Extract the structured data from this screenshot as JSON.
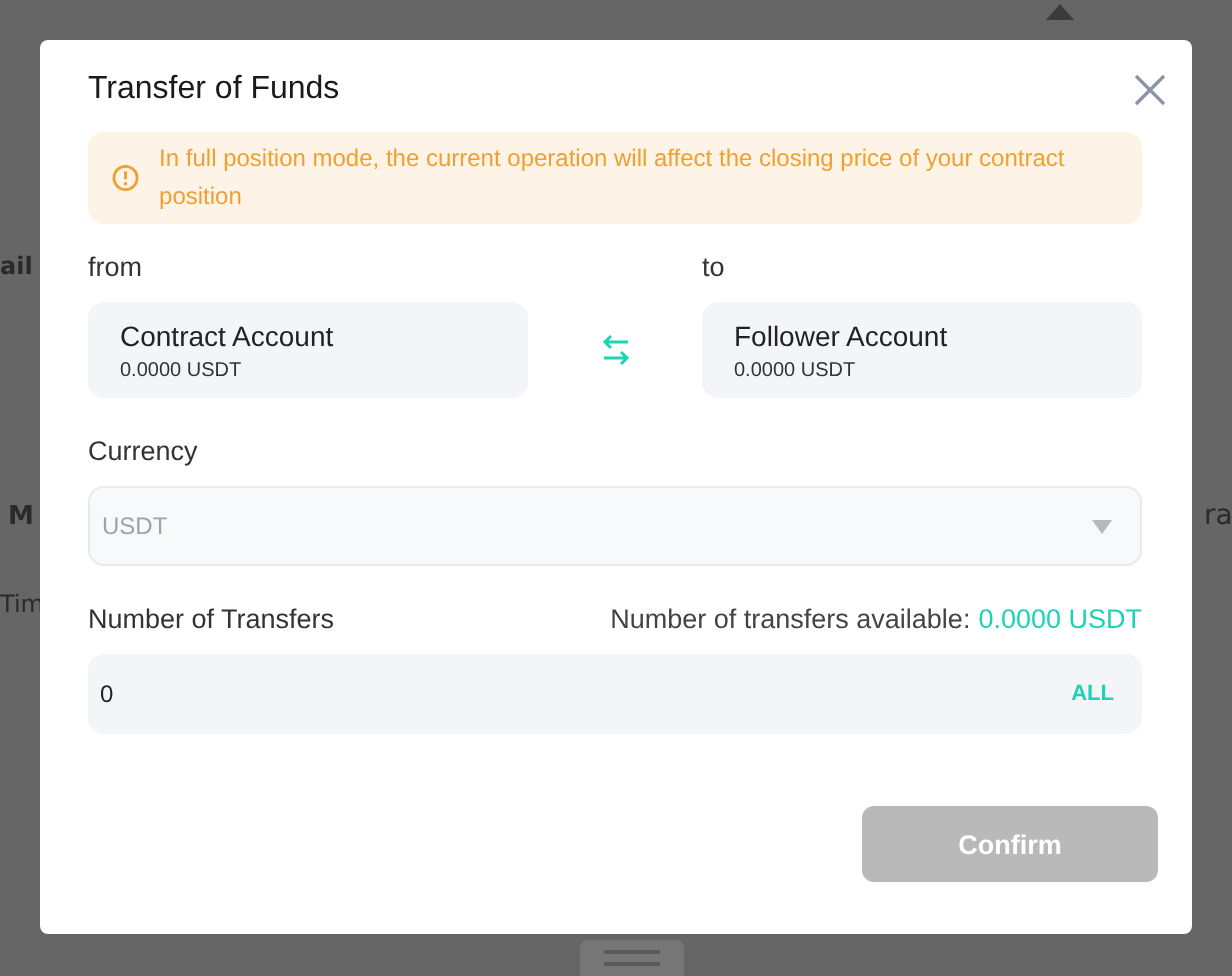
{
  "background": {
    "fragments": [
      "ail",
      "M",
      "Tim",
      "ra"
    ]
  },
  "dialog": {
    "title": "Transfer of Funds",
    "notice": "In full position mode, the current operation will affect the closing price of your contract position",
    "from": {
      "label": "from",
      "account": "Contract Account",
      "balance": "0.0000 USDT"
    },
    "to": {
      "label": "to",
      "account": "Follower Account",
      "balance": "0.0000 USDT"
    },
    "currency": {
      "label": "Currency",
      "value": "USDT",
      "disabled": true
    },
    "amount": {
      "label": "Number of Transfers",
      "available_label": "Number of transfers available:",
      "available_value": "0.0000 USDT",
      "value": "0",
      "all_button": "ALL"
    },
    "confirm": {
      "label": "Confirm",
      "disabled": true
    }
  }
}
